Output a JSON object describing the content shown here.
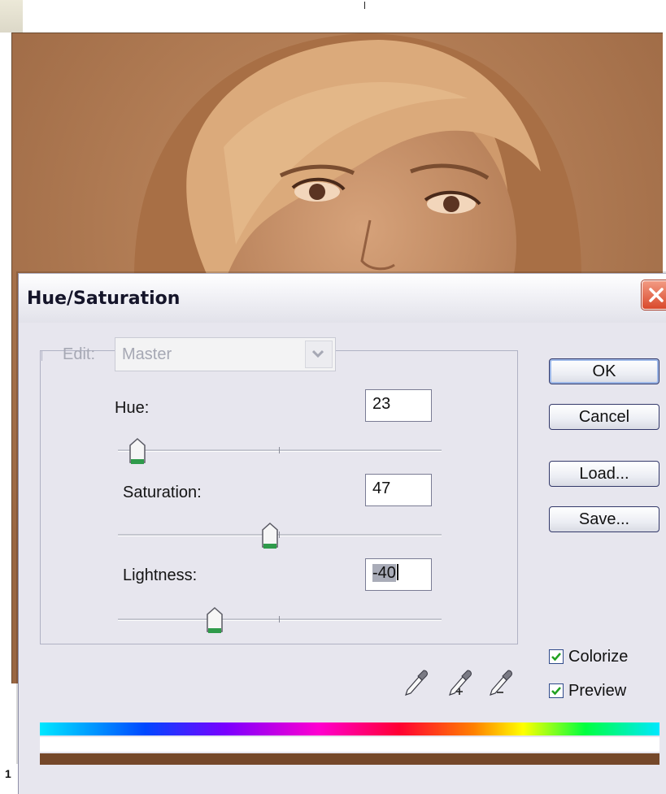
{
  "window": {
    "title": "Hue/Saturation"
  },
  "edit": {
    "label": "Edit:",
    "value": "Master"
  },
  "hue": {
    "label": "Hue:",
    "value": "23",
    "fraction": 0.06
  },
  "saturation": {
    "label": "Saturation:",
    "value": "47",
    "fraction": 0.47
  },
  "lightness": {
    "label": "Lightness:",
    "value_selected": "-40",
    "fraction": 0.3
  },
  "buttons": {
    "ok": "OK",
    "cancel": "Cancel",
    "load": "Load...",
    "save": "Save..."
  },
  "checkboxes": {
    "colorize": {
      "label": "Colorize",
      "checked": true
    },
    "preview": {
      "label": "Preview",
      "checked": true
    }
  },
  "icons": [
    "close-icon",
    "eyedropper-icon",
    "eyedropper-plus-icon",
    "eyedropper-minus-icon",
    "chevron-down-icon",
    "checkmark-icon"
  ],
  "colors": {
    "photo_tint": "#b07a52",
    "result_bar": "#75482a",
    "close_button": "#d9492c"
  },
  "edge_mark": "1"
}
